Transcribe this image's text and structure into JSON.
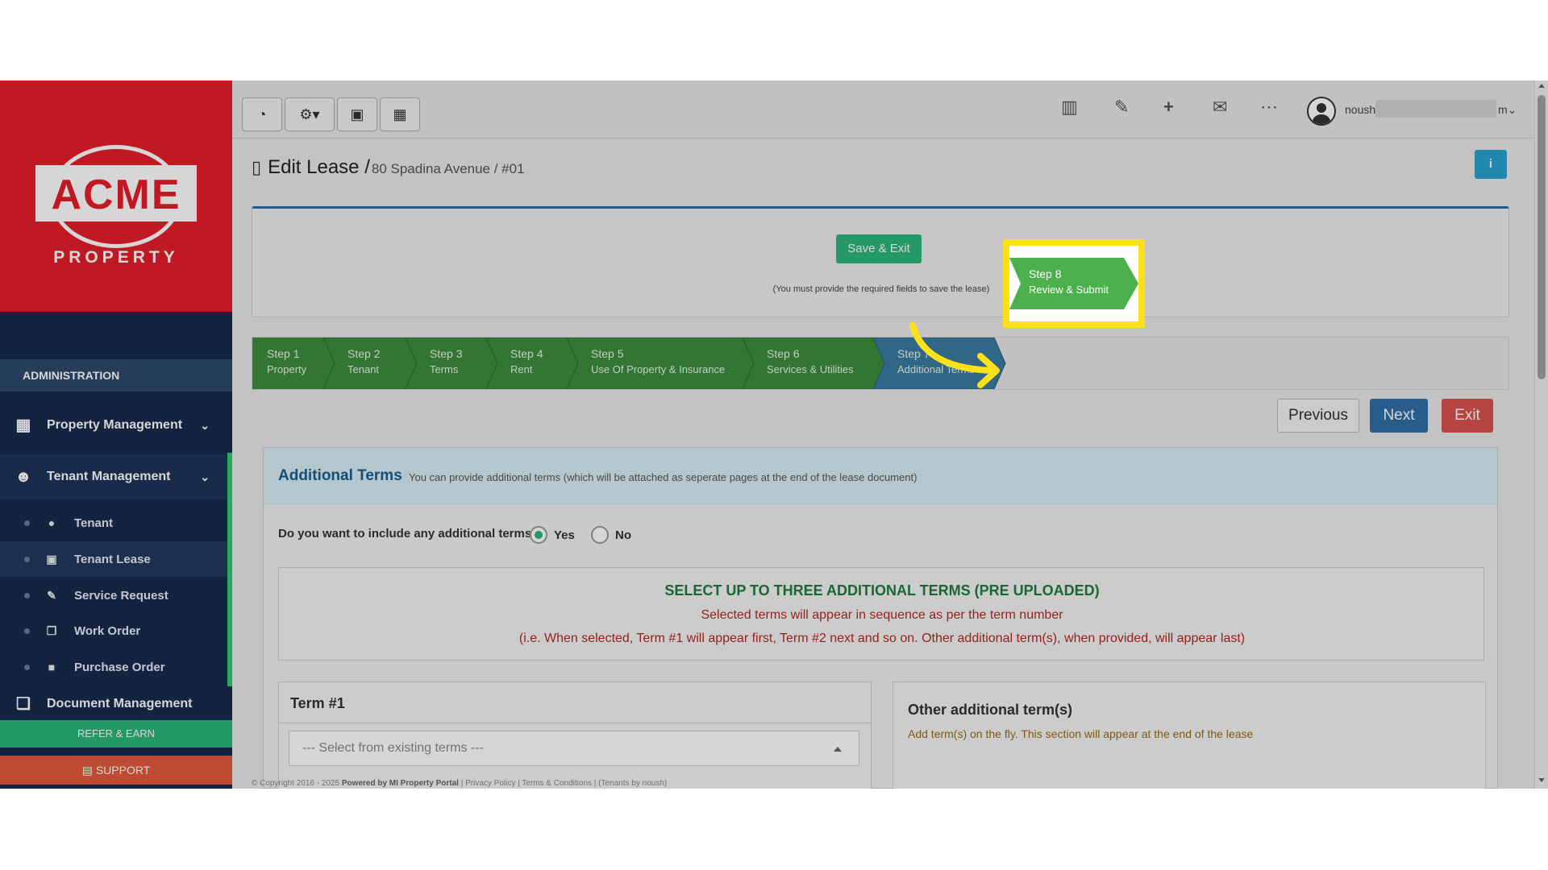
{
  "brand": {
    "name": "ACME",
    "sub": "PROPERTY"
  },
  "sidebar": {
    "section_label": "ADMINISTRATION",
    "menus": [
      {
        "label": "Property Management",
        "icon": "building-icon"
      },
      {
        "label": "Tenant Management",
        "icon": "users-icon"
      },
      {
        "label": "Document Management",
        "icon": "documents-icon"
      }
    ],
    "sub_items": [
      {
        "label": "Tenant",
        "icon": "user-icon"
      },
      {
        "label": "Tenant Lease",
        "icon": "calendar-check-icon"
      },
      {
        "label": "Service Request",
        "icon": "wrench-icon"
      },
      {
        "label": "Work Order",
        "icon": "copy-icon"
      },
      {
        "label": "Purchase Order",
        "icon": "truck-icon"
      }
    ],
    "refer_label": "REFER & EARN",
    "support_label": "SUPPORT"
  },
  "topbar": {
    "user_name": "noush",
    "user_tail": "m"
  },
  "page": {
    "title": "Edit Lease /",
    "subtitle": "80 Spadina Avenue / #01",
    "info_label": "i"
  },
  "save": {
    "button_label": "Save & Exit",
    "note": "(You must provide the required fields to save the lease)"
  },
  "steps": [
    {
      "title": "Step 1",
      "name": "Property"
    },
    {
      "title": "Step 2",
      "name": "Tenant"
    },
    {
      "title": "Step 3",
      "name": "Terms"
    },
    {
      "title": "Step 4",
      "name": "Rent"
    },
    {
      "title": "Step 5",
      "name": "Use Of Property & Insurance"
    },
    {
      "title": "Step 6",
      "name": "Services & Utilities"
    },
    {
      "title": "Step 7",
      "name": "Additional Terms"
    },
    {
      "title": "Step 8",
      "name": "Review & Submit"
    }
  ],
  "nav": {
    "previous_label": "Previous",
    "next_label": "Next",
    "exit_label": "Exit"
  },
  "additional_terms": {
    "title": "Additional Terms",
    "description": "You can provide additional terms (which will be attached as seperate pages at the end of the lease document)",
    "question": "Do you want to include any additional terms?",
    "yes_label": "Yes",
    "no_label": "No",
    "notice_title": "SELECT UP TO THREE ADDITIONAL TERMS (PRE UPLOADED)",
    "notice_line1": "Selected terms will appear in sequence as per the term number",
    "notice_line2": "(i.e. When selected, Term #1 will appear first, Term #2 next and so on. Other additional term(s), when provided, will appear last)",
    "term1_title": "Term #1",
    "term1_placeholder": "--- Select from existing terms ---",
    "other_title": "Other additional term(s)",
    "other_note": "Add term(s) on the fly. This section will appear at the end of the lease"
  },
  "footer": {
    "copyright": "© Copyright 2016 - 2025",
    "powered": "Powered by MI Property Portal",
    "links": "| Privacy Policy | Terms & Conditions |",
    "tenant": "(Tenants by noush)"
  },
  "colors": {
    "brand_red": "#e61e2a",
    "sidebar_navy": "#172b4d",
    "step_green": "#3d8c3d",
    "step_blue": "#3a7aa0",
    "highlight_yellow": "#ffe11a",
    "next_blue": "#2f6fa6",
    "exit_red": "#d9534f"
  }
}
